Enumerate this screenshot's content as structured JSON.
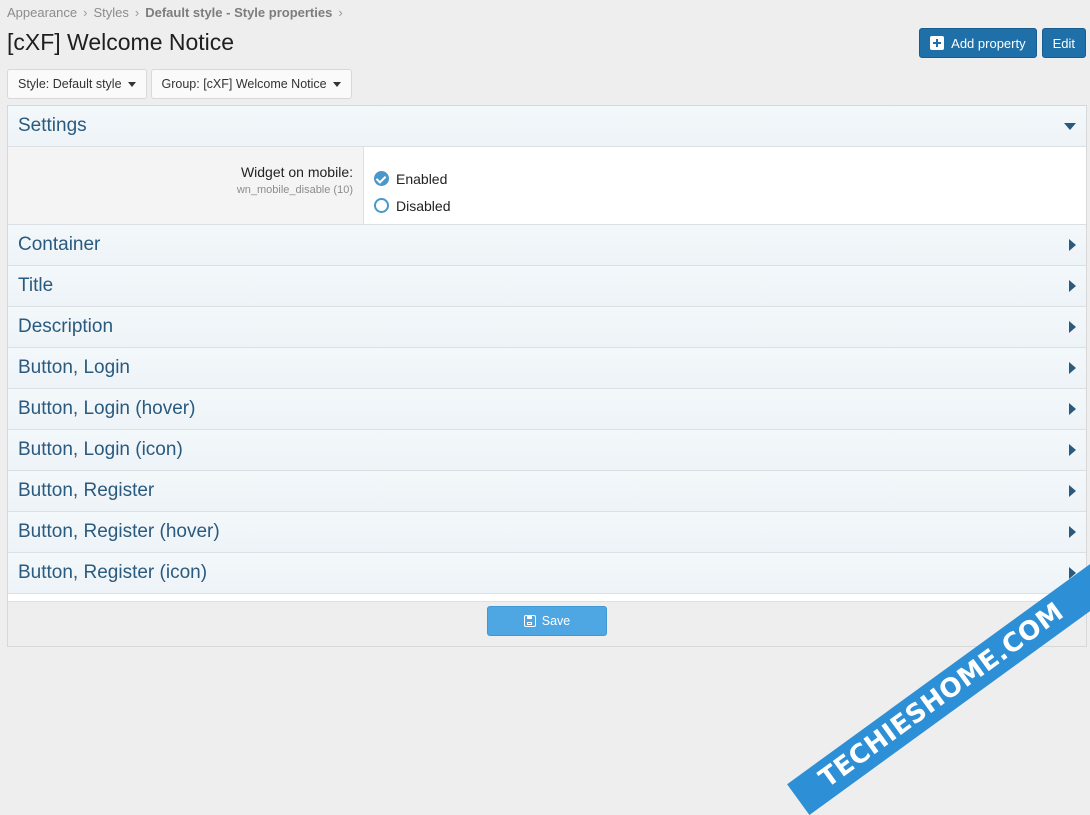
{
  "breadcrumb": {
    "items": [
      "Appearance",
      "Styles",
      "Default style - Style properties"
    ],
    "separator": "›"
  },
  "page": {
    "title": "[cXF] Welcome Notice"
  },
  "actions": {
    "add_property": "Add property",
    "edit": "Edit"
  },
  "filters": {
    "style": "Style: Default style",
    "group": "Group: [cXF] Welcome Notice"
  },
  "settings_section": {
    "title": "Settings",
    "row": {
      "label": "Widget on mobile:",
      "hint": "wn_mobile_disable (10)",
      "options": [
        {
          "label": "Enabled",
          "selected": true
        },
        {
          "label": "Disabled",
          "selected": false
        }
      ]
    }
  },
  "sections": [
    "Container",
    "Title",
    "Description",
    "Button, Login",
    "Button, Login (hover)",
    "Button, Login (icon)",
    "Button, Register",
    "Button, Register (hover)",
    "Button, Register (icon)"
  ],
  "footer": {
    "save": "Save"
  },
  "watermark": {
    "text": "TECHIESHOME.COM"
  },
  "colors": {
    "primary": "#1f6fa8",
    "accent": "#4ea6e2",
    "section_text": "#2a5a7e"
  }
}
